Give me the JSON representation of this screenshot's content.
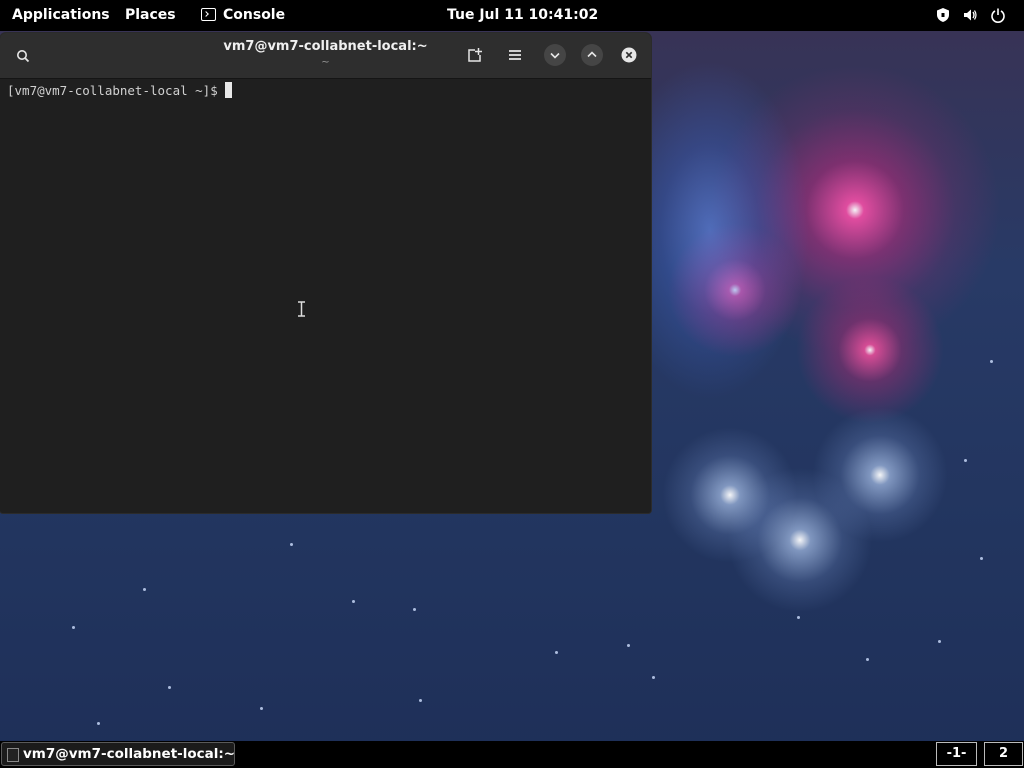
{
  "top_panel": {
    "applications_label": "Applications",
    "places_label": "Places",
    "console_label": "Console",
    "clock": "Tue Jul 11  10:41:02",
    "tray_icons": [
      "shield-icon",
      "volume-icon",
      "power-icon"
    ]
  },
  "terminal": {
    "title": "vm7@vm7-collabnet-local:~",
    "subtitle": "~",
    "prompt": "[vm7@vm7-collabnet-local ~]$ ",
    "header_icons": [
      "search-icon",
      "new-tab-icon",
      "hamburger-menu-icon",
      "minimize-icon",
      "maximize-icon",
      "close-icon"
    ]
  },
  "taskbar": {
    "window_label": "vm7@vm7-collabnet-local:~",
    "workspaces": [
      {
        "label": "-1-",
        "active": true
      },
      {
        "label": "2",
        "active": false
      }
    ]
  }
}
